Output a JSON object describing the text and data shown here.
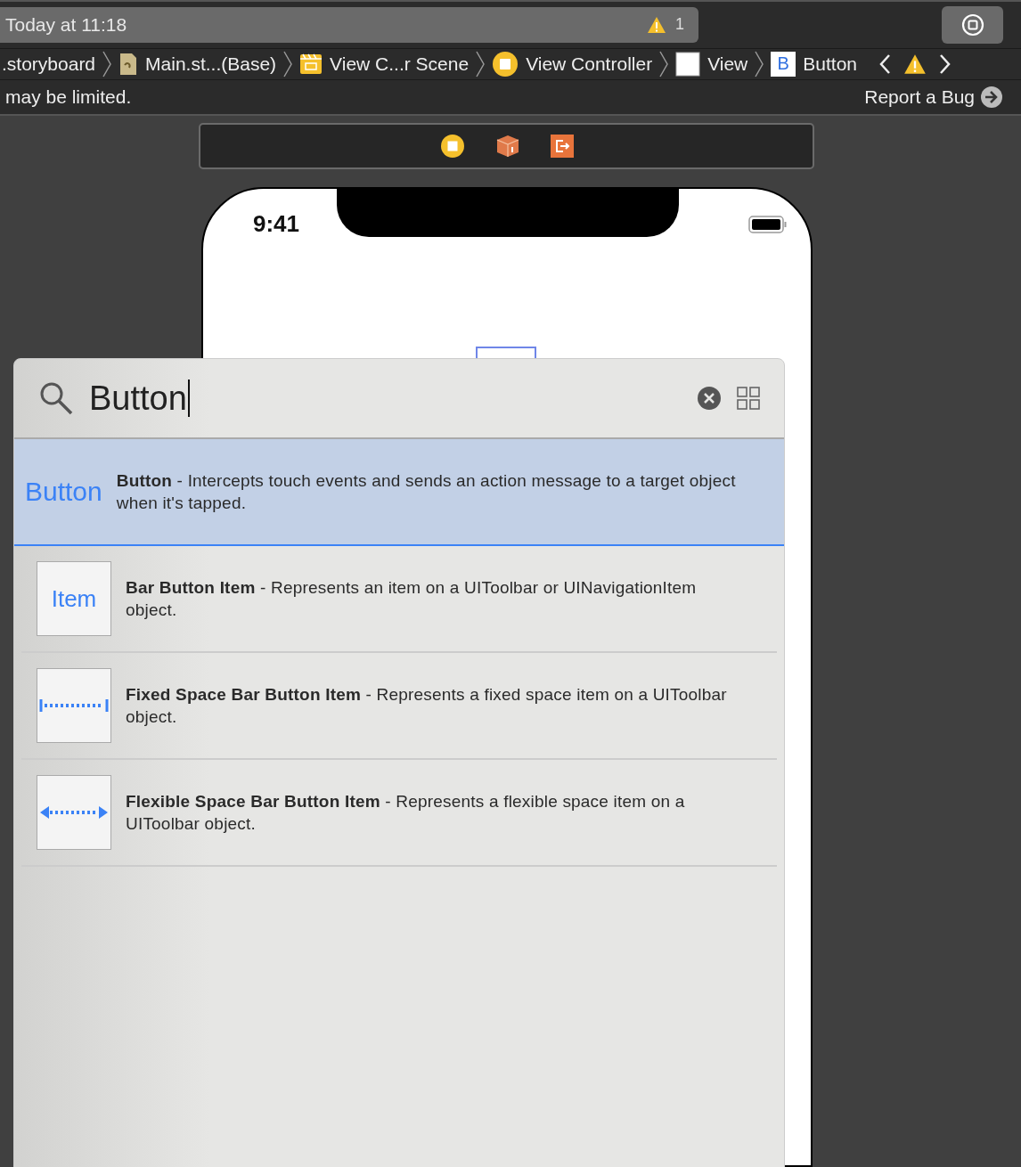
{
  "activity": {
    "status": "Today at 11:18",
    "warning_count": "1"
  },
  "breadcrumbs": [
    {
      "kind": "storyboard",
      "label": ".storyboard"
    },
    {
      "kind": "file",
      "label": "Main.st...(Base)"
    },
    {
      "kind": "scene",
      "label": "View C...r Scene"
    },
    {
      "kind": "controller",
      "label": "View Controller"
    },
    {
      "kind": "view",
      "label": "View"
    },
    {
      "kind": "button",
      "label": "Button",
      "icon_text": "B"
    }
  ],
  "info_bar": {
    "message": "may be limited.",
    "action": "Report a Bug"
  },
  "device": {
    "time": "9:41"
  },
  "library": {
    "query": "Button",
    "items": [
      {
        "kind": "text",
        "preview": "Button",
        "description": "**Button** - Intercepts touch events and sends an action message to a target object when it's tapped.",
        "selected": true
      },
      {
        "kind": "item",
        "preview": "Item",
        "description": "**Bar Button Item** - Represents an item on a UIToolbar or UINavigationItem object.",
        "selected": false
      },
      {
        "kind": "fixed",
        "description": "**Fixed Space Bar Button Item** - Represents a fixed space item on a UIToolbar object.",
        "selected": false
      },
      {
        "kind": "flexible",
        "description": "**Flexible Space Bar Button Item** - Represents a flexible space item on a UIToolbar object.",
        "selected": false
      }
    ]
  }
}
